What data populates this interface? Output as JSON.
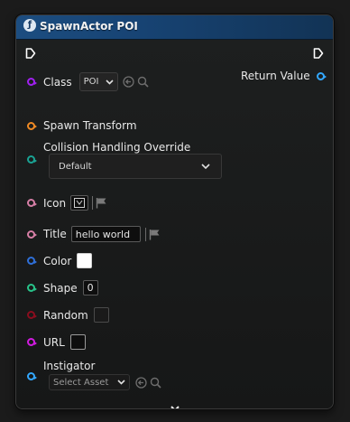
{
  "node": {
    "title": "SpawnActor POI",
    "header_color": "#1c4d80"
  },
  "inputs": {
    "class": {
      "label": "Class",
      "value": "POI"
    },
    "spawn_transform": {
      "label": "Spawn Transform"
    },
    "collision": {
      "label": "Collision Handling Override",
      "value": "Default"
    },
    "icon": {
      "label": "Icon"
    },
    "title": {
      "label": "Title",
      "value": "hello world"
    },
    "color": {
      "label": "Color",
      "value": "#ffffff"
    },
    "shape": {
      "label": "Shape",
      "value": "0"
    },
    "random": {
      "label": "Random"
    },
    "url": {
      "label": "URL"
    },
    "instigator": {
      "label": "Instigator",
      "value": "Select Asset"
    }
  },
  "outputs": {
    "return_value": {
      "label": "Return Value"
    }
  },
  "pin_colors": {
    "class": "#a020f0",
    "transform": "#f08a24",
    "collision": "#1aa394",
    "icon": "#d67fa6",
    "title": "#d67fa6",
    "color": "#2f6fd8",
    "shape": "#28c48a",
    "random": "#8a0d1e",
    "url": "#d11be0",
    "object": "#33a8ff"
  },
  "icons": {
    "header": "function-icon",
    "exec_in": "exec-in-pin-icon",
    "exec_out": "exec-out-pin-icon",
    "use_selected": "back-arrow-circle-icon",
    "browse": "search-icon",
    "flag": "flag-icon",
    "expand": "chevron-down-icon"
  }
}
